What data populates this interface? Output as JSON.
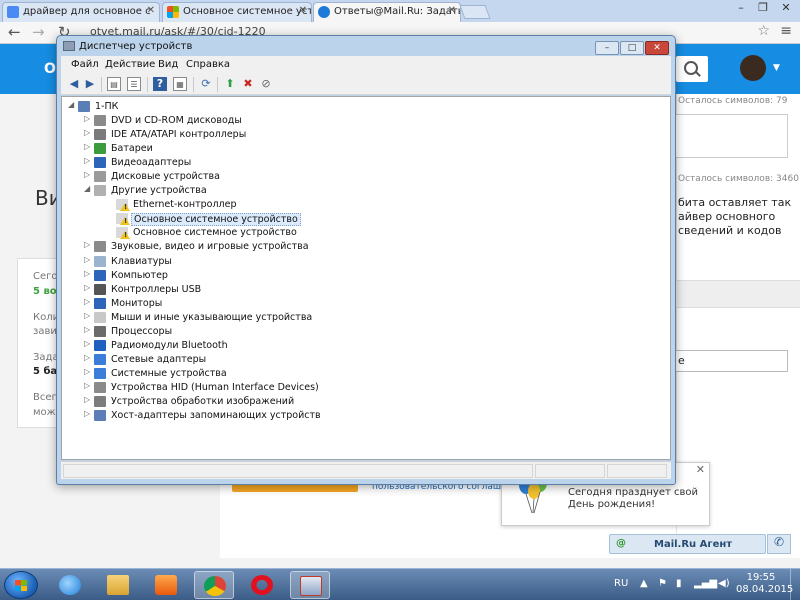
{
  "browser": {
    "tabs": [
      {
        "title": "драйвер для основное с",
        "color": "#4a8af4"
      },
      {
        "title": "Основное системное уст",
        "color": "#2f9e44"
      },
      {
        "title": "Ответы@Mail.Ru: Задать",
        "color": "#1d7ad8"
      }
    ],
    "url": "otvet.mail.ru/ask/#/30/cid-1220"
  },
  "page": {
    "logo": "О",
    "big_text": "Ви",
    "stats": [
      "Сего",
      "5 во",
      "Коли",
      "зави",
      "Зада",
      "5 ба",
      "Всег",
      "мож"
    ],
    "right": {
      "chars_left_1": "Осталось символов: 79",
      "chars_left_2": "Осталось символов: 3460",
      "body_lines": [
        "бита оставляет так",
        "айвер основного",
        "сведений и кодов"
      ],
      "select_value": "е"
    },
    "link_text": "пользовательского соглашени"
  },
  "device_manager": {
    "title": "Диспетчер устройств",
    "menu": [
      "Файл",
      "Действие",
      "Вид",
      "Справка"
    ],
    "root": "1-ПК",
    "tree": [
      {
        "label": "DVD и CD-ROM дисководы",
        "icon": "dvd-drive-icon",
        "color": "#8a8a8a",
        "level": 1
      },
      {
        "label": "IDE ATA/ATAPI контроллеры",
        "icon": "ide-controller-icon",
        "color": "#7a7a7a",
        "level": 1
      },
      {
        "label": "Батареи",
        "icon": "battery-icon",
        "color": "#3c9b3c",
        "level": 1
      },
      {
        "label": "Видеоадаптеры",
        "icon": "display-adapter-icon",
        "color": "#2d63b8",
        "level": 1
      },
      {
        "label": "Дисковые устройства",
        "icon": "disk-drive-icon",
        "color": "#9a9a9a",
        "level": 1
      },
      {
        "label": "Другие устройства",
        "icon": "other-devices-icon",
        "color": "#b0b0b0",
        "level": 1,
        "expanded": true
      },
      {
        "label": "Ethernet-контроллер",
        "icon": "unknown-device-warning-icon",
        "color": "#d9d9d9",
        "level": 2,
        "warn": true
      },
      {
        "label": "Основное системное устройство",
        "icon": "unknown-device-warning-icon",
        "color": "#d9d9d9",
        "level": 2,
        "warn": true,
        "selected": true
      },
      {
        "label": "Основное системное устройство",
        "icon": "unknown-device-warning-icon",
        "color": "#d9d9d9",
        "level": 2,
        "warn": true
      },
      {
        "label": "Звуковые, видео и игровые устройства",
        "icon": "sound-icon",
        "color": "#8a8a8a",
        "level": 1
      },
      {
        "label": "Клавиатуры",
        "icon": "keyboard-icon",
        "color": "#9ab3cf",
        "level": 1
      },
      {
        "label": "Компьютер",
        "icon": "computer-icon",
        "color": "#2d63b8",
        "level": 1
      },
      {
        "label": "Контроллеры USB",
        "icon": "usb-icon",
        "color": "#555555",
        "level": 1
      },
      {
        "label": "Мониторы",
        "icon": "monitor-icon",
        "color": "#2d63b8",
        "level": 1
      },
      {
        "label": "Мыши и иные указывающие устройства",
        "icon": "mouse-icon",
        "color": "#c8c8c8",
        "level": 1
      },
      {
        "label": "Процессоры",
        "icon": "processor-icon",
        "color": "#6b6b6b",
        "level": 1
      },
      {
        "label": "Радиомодули Bluetooth",
        "icon": "bluetooth-icon",
        "color": "#1f5fbf",
        "level": 1
      },
      {
        "label": "Сетевые адаптеры",
        "icon": "network-adapter-icon",
        "color": "#3b7dd8",
        "level": 1
      },
      {
        "label": "Системные устройства",
        "icon": "system-devices-icon",
        "color": "#3b7dd8",
        "level": 1
      },
      {
        "label": "Устройства HID (Human Interface Devices)",
        "icon": "hid-icon",
        "color": "#8a8a8a",
        "level": 1
      },
      {
        "label": "Устройства обработки изображений",
        "icon": "imaging-device-icon",
        "color": "#7d7d7d",
        "level": 1
      },
      {
        "label": "Хост-адаптеры запоминающих устройств",
        "icon": "storage-controller-icon",
        "color": "#5b7db8",
        "level": 1
      }
    ]
  },
  "notification": {
    "line1": "Сегодня празднует свой",
    "line2": "День рождения!"
  },
  "agent": {
    "label": "Mail.Ru Агент",
    "at": "@"
  },
  "taskbar": {
    "lang": "RU",
    "time": "19:55",
    "date": "08.04.2015"
  }
}
